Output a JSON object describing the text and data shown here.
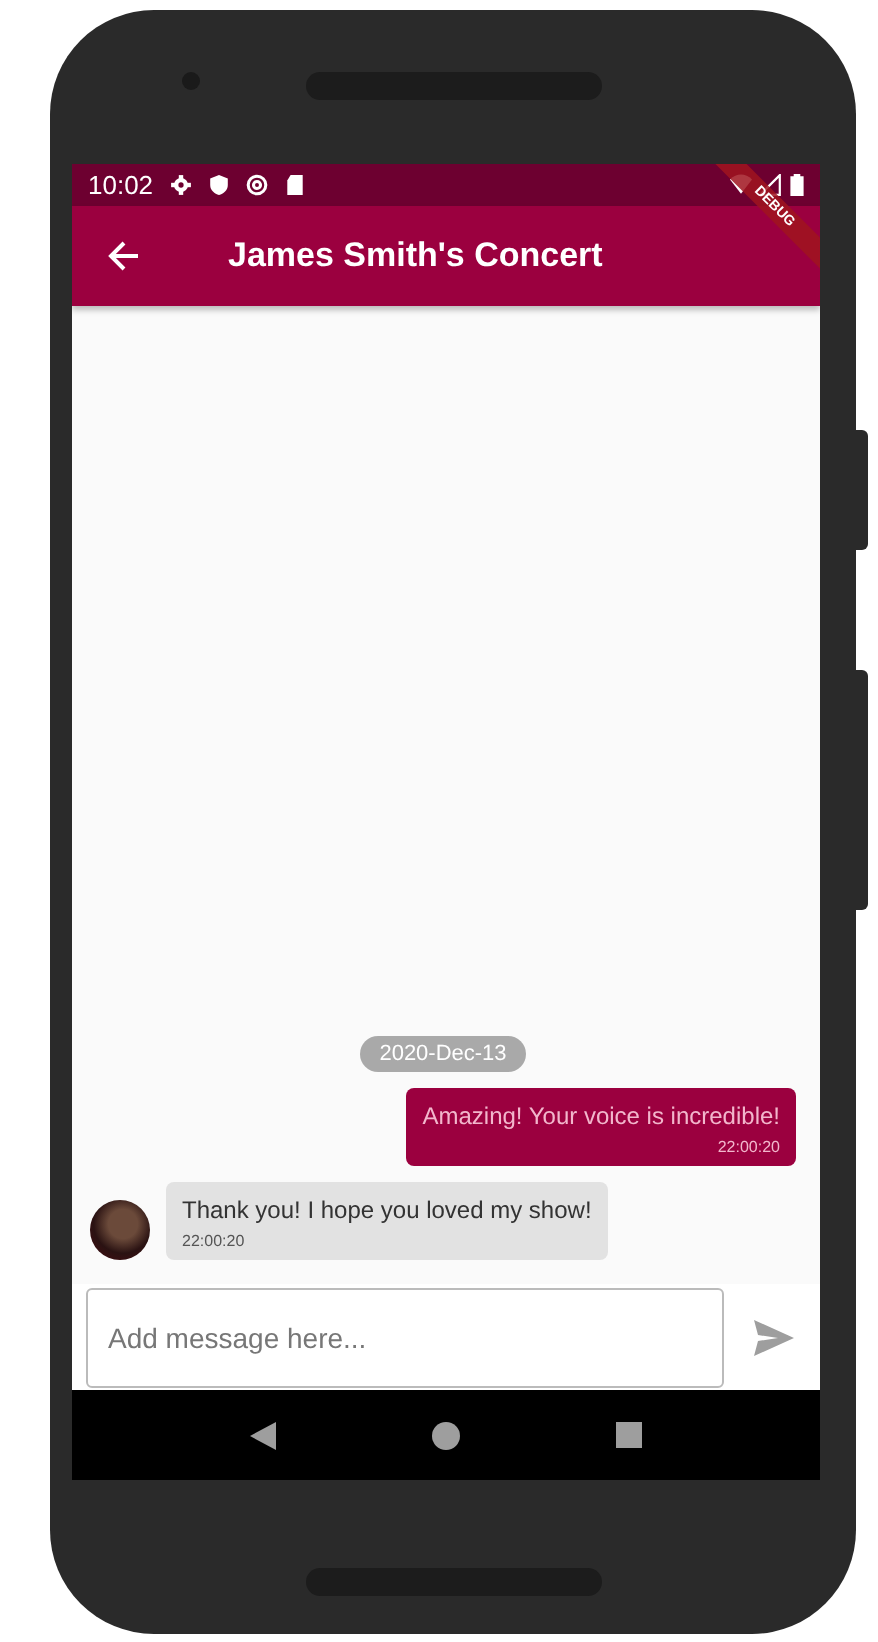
{
  "status_bar": {
    "time": "10:02"
  },
  "app_bar": {
    "title": "James Smith's Concert"
  },
  "debug_banner": "DEBUG",
  "messages": [
    {
      "kind": "date",
      "text": "2020-Dec-13"
    },
    {
      "kind": "sent",
      "text": "Amazing! Your voice is incredible!",
      "time": "22:00:20"
    },
    {
      "kind": "received",
      "text": "Thank you! I hope you loved my show!",
      "time": "22:00:20"
    }
  ],
  "composer": {
    "placeholder": "Add message here..."
  }
}
